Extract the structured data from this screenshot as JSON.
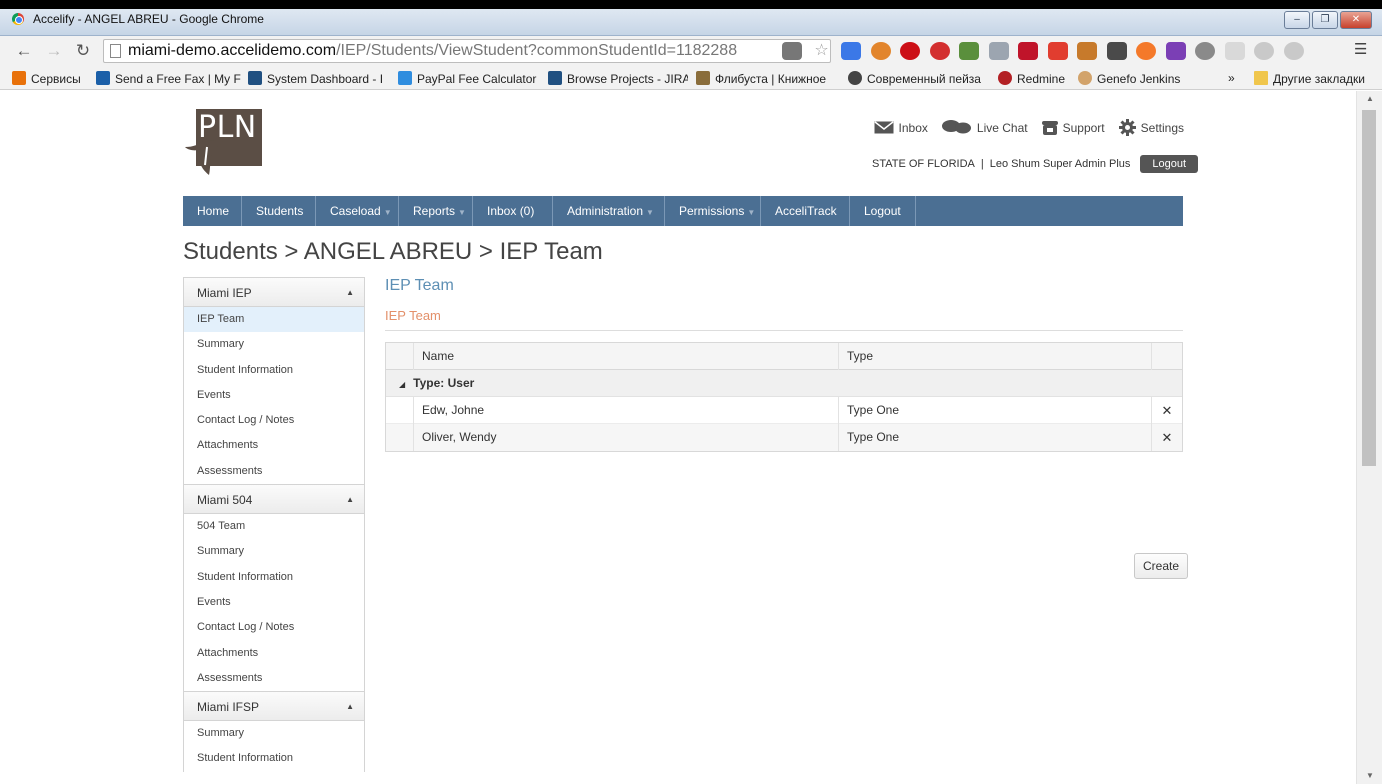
{
  "window": {
    "title": "Accelify - ANGEL ABREU - Google Chrome",
    "controls": [
      "–",
      "❐",
      "✕"
    ]
  },
  "browser": {
    "url_host": "miami-demo.accelidemo.com",
    "url_path": "/IEP/Students/ViewStudent?commonStudentId=1182288",
    "bookmarks": [
      {
        "label": "Сервисы",
        "icon": "apps-grid-icon",
        "color": "#e8710a"
      },
      {
        "label": "Send a Free Fax | My F",
        "icon": "fax-icon",
        "color": "#1b5fa8"
      },
      {
        "label": "System Dashboard - I",
        "icon": "jira-icon",
        "color": "#205081"
      },
      {
        "label": "PayPal Fee Calculator",
        "icon": "paypal-icon",
        "color": "#2f8ddf"
      },
      {
        "label": "Browse Projects - JIRA",
        "icon": "jira-icon",
        "color": "#205081"
      },
      {
        "label": "Флибуста | Книжное",
        "icon": "book-icon",
        "color": "#8a6d3b"
      },
      {
        "label": "Современный пейза",
        "icon": "art-icon",
        "color": "#444444"
      },
      {
        "label": "Redmine",
        "icon": "redmine-icon",
        "color": "#b32024"
      },
      {
        "label": "Genefo Jenkins",
        "icon": "jenkins-icon",
        "color": "#d2a36b"
      }
    ],
    "bookmarks_overflow": "»",
    "other_bookmarks": "Другие закладки"
  },
  "header": {
    "logo_text": "PLN",
    "util_links": [
      {
        "label": "Inbox",
        "icon": "envelope-icon"
      },
      {
        "label": "Live Chat",
        "icon": "chat-bubbles-icon"
      },
      {
        "label": "Support",
        "icon": "phone-icon"
      },
      {
        "label": "Settings",
        "icon": "gear-icon"
      }
    ],
    "state": "STATE OF FLORIDA",
    "separator": "|",
    "user": "Leo Shum Super Admin Plus",
    "logout": "Logout"
  },
  "nav": [
    {
      "label": "Home",
      "dropdown": false
    },
    {
      "label": "Students",
      "dropdown": false
    },
    {
      "label": "Caseload",
      "dropdown": true
    },
    {
      "label": "Reports",
      "dropdown": true
    },
    {
      "label": "Inbox (0)",
      "dropdown": false
    },
    {
      "label": "Administration",
      "dropdown": true
    },
    {
      "label": "Permissions",
      "dropdown": true
    },
    {
      "label": "AcceliTrack",
      "dropdown": false
    },
    {
      "label": "Logout",
      "dropdown": false
    }
  ],
  "breadcrumb": "Students > ANGEL ABREU > IEP Team",
  "sidebar": {
    "sections": [
      {
        "title": "Miami IEP",
        "items": [
          "IEP Team",
          "Summary",
          "Student Information",
          "Events",
          "Contact Log / Notes",
          "Attachments",
          "Assessments"
        ],
        "active": 0
      },
      {
        "title": "Miami 504",
        "items": [
          "504 Team",
          "Summary",
          "Student Information",
          "Events",
          "Contact Log / Notes",
          "Attachments",
          "Assessments"
        ],
        "active": -1
      },
      {
        "title": "Miami IFSP",
        "items": [
          "Summary",
          "Student Information"
        ],
        "active": -1
      }
    ]
  },
  "main": {
    "heading": "IEP Team",
    "subheading": "IEP Team",
    "grid": {
      "columns": [
        "Name",
        "Type"
      ],
      "group_label": "Type: User",
      "rows": [
        {
          "name": "Edw, Johne",
          "type": "Type One"
        },
        {
          "name": "Oliver, Wendy",
          "type": "Type One"
        }
      ],
      "delete_glyph": "✕"
    },
    "create_label": "Create"
  },
  "colors": {
    "nav_bg": "#4b6f93",
    "heading_blue": "#5d8fb4",
    "subheading_orange": "#e3906a",
    "logo_brown": "#5b4e45",
    "active_item_bg": "#e3f0fb"
  }
}
